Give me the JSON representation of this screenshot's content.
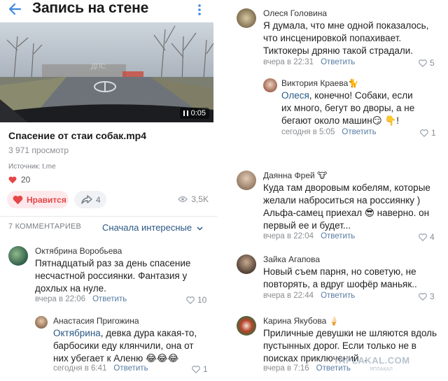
{
  "header": {
    "title": "Запись на стене"
  },
  "video": {
    "duration": "0:05",
    "plate_text": "ДПС"
  },
  "post": {
    "title": "Спасение от стаи собак.mp4",
    "views": "3 971 просмотр",
    "source": "Источник: t.me",
    "likes": "20",
    "like_button": "Нравится",
    "shares": "4",
    "view_count": "3,5K"
  },
  "comments_section": {
    "count_label": "7 КОММЕНТАРИЕВ",
    "sort_label": "Сначала интересные"
  },
  "comments": [
    {
      "author": "Октябрина Воробьева",
      "text": "Пятнадцатый раз за день спасение несчастной россиянки. Фантазия у дохлых на нуле.",
      "time": "вчера в 22:06",
      "reply": "Ответить",
      "likes": "10"
    },
    {
      "author": "Анастасия Пригожина",
      "mention": "Октябрина",
      "text": ", девка дура какая-то, барбосики еду клянчили, она от них убегает к Аленю 😂😂😂",
      "time": "сегодня в 6:41",
      "reply": "Ответить",
      "likes": "1"
    },
    {
      "author": "Олеся Головина",
      "text": "Я думала, что мне одной показалось, что инсценировкой попахивает. Тиктокеры дряню такой страдали.",
      "time": "вчера в 22:31",
      "reply": "Ответить",
      "likes": "5"
    },
    {
      "author": "Виктория Краева",
      "badge": "🐈",
      "mention": "Олеся",
      "text": ", конечно! Собаки, если их много, бегут во дворы, а не бегают около машин😏 👇!",
      "time": "сегодня в 5:05",
      "reply": "Ответить",
      "likes": "1"
    },
    {
      "author": "Даянна Фрей",
      "badge": "🐮",
      "text": "Куда там дворовым кобелям, которые желали наброситься на россиянку ) Альфа-самец приехал 😎 наверно. он первый ее и будет...",
      "time": "вчера в 22:04",
      "reply": "Ответить",
      "likes": "4"
    },
    {
      "author": "Зайка Агапова",
      "text": "Новый съем парня, но советую, не повторять, а вдруг шофёр маньяк..",
      "time": "вчера в 22:44",
      "reply": "Ответить",
      "likes": "3"
    },
    {
      "author": "Карина Якубова",
      "badge": "🍦",
      "text": "Приличные девушки не шляются вдоль пустынных дорог. Если только не в поисках приключений...",
      "time": "вчера в 7:16",
      "reply": "Ответить",
      "likes": ""
    }
  ],
  "watermark": {
    "main": "YAPLAKAL.COM",
    "sub": "ЯПЛАКАЛ"
  },
  "colors": {
    "accent": "#2a5885",
    "like_red": "#e64646",
    "meta_gray": "#8a8d91"
  }
}
